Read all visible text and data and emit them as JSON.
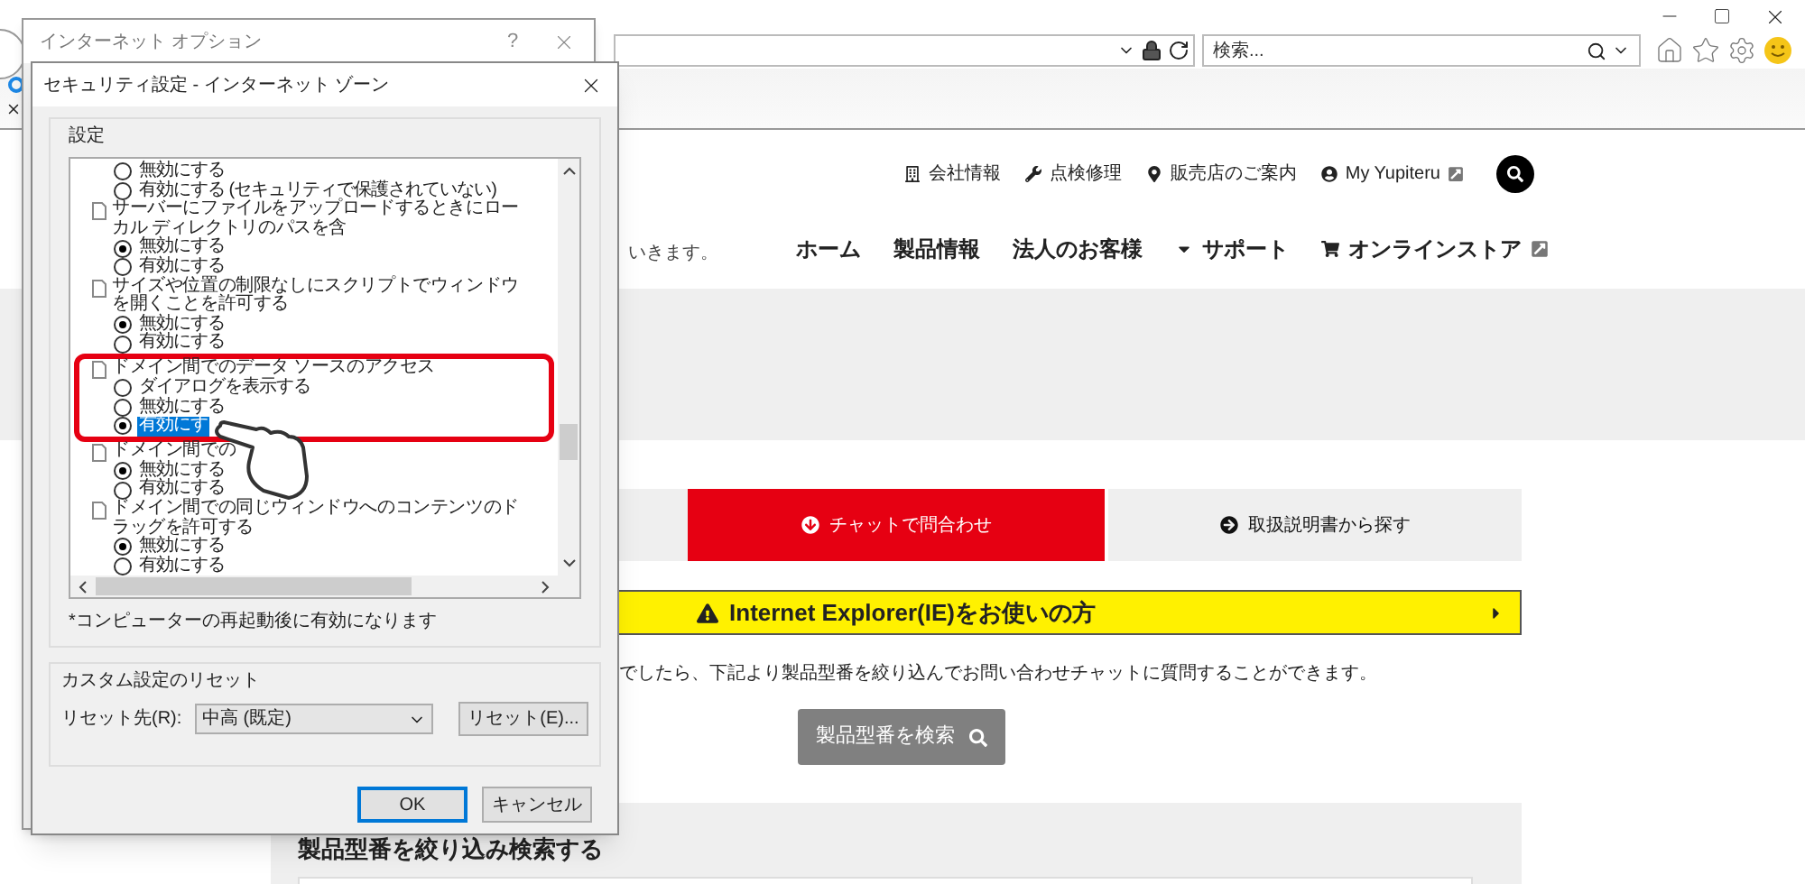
{
  "browser": {
    "search_placeholder": "検索..."
  },
  "site": {
    "utility_links": [
      {
        "label": "会社情報",
        "external": false
      },
      {
        "label": "点検修理",
        "external": false
      },
      {
        "label": "販売店のご案内",
        "external": false
      },
      {
        "label": "My Yupiteru",
        "external": true
      }
    ],
    "main_nav": [
      {
        "label": "ホーム",
        "has_menu": false,
        "external": false
      },
      {
        "label": "製品情報",
        "has_menu": false,
        "external": false
      },
      {
        "label": "法人のお客様",
        "has_menu": false,
        "external": false
      },
      {
        "label": "サポート",
        "has_menu": true,
        "external": false
      },
      {
        "label": "オンラインストア",
        "has_menu": false,
        "external": true
      }
    ],
    "tagline": "いきます。",
    "contact_tabs": [
      {
        "label": "チャットで問合わせ",
        "selected": true
      },
      {
        "label": "取扱説明書から探す",
        "selected": false
      }
    ],
    "ie_banner": "Internet Explorer(IE)をお使いの方",
    "description": "でしたら、下記より製品型番を絞り込んでお問い合わせチャットに質問することができます。",
    "search_button": "製品型番を検索",
    "section_heading": "製品型番を絞り込み検索する"
  },
  "options_dialog": {
    "title": "インターネット オプション",
    "help": "?"
  },
  "security_dialog": {
    "title": "セキュリティ設定 - インターネット ゾーン",
    "settings_label": "設定",
    "items": [
      {
        "kind": "option",
        "label": "無効にする",
        "selected": false,
        "callout": false
      },
      {
        "kind": "option",
        "label": "有効にする (セキュリティで保護されていない)",
        "selected": false,
        "callout": false
      },
      {
        "kind": "group",
        "label": "サーバーにファイルをアップロードするときにローカル ディレクトリのパスを含",
        "callout": false
      },
      {
        "kind": "option",
        "label": "無効にする",
        "selected": true,
        "callout": false
      },
      {
        "kind": "option",
        "label": "有効にする",
        "selected": false,
        "callout": false
      },
      {
        "kind": "group",
        "label": "サイズや位置の制限なしにスクリプトでウィンドウを開くことを許可する",
        "callout": false
      },
      {
        "kind": "option",
        "label": "無効にする",
        "selected": true,
        "callout": false
      },
      {
        "kind": "option",
        "label": "有効にする",
        "selected": false,
        "callout": false
      },
      {
        "kind": "group",
        "label": "ドメイン間でのデータ ソースのアクセス",
        "callout": true
      },
      {
        "kind": "option",
        "label": "ダイアログを表示する",
        "selected": false,
        "callout": true
      },
      {
        "kind": "option",
        "label": "無効にする",
        "selected": false,
        "callout": true
      },
      {
        "kind": "option",
        "label": "有効にす",
        "selected": true,
        "focused": true,
        "callout": true
      },
      {
        "kind": "group",
        "label": "ドメイン間での",
        "callout": false
      },
      {
        "kind": "option",
        "label": "無効にする",
        "selected": true,
        "callout": false
      },
      {
        "kind": "option",
        "label": "有効にする",
        "selected": false,
        "callout": false
      },
      {
        "kind": "group",
        "label": "ドメイン間での同じウィンドウへのコンテンツのドラッグを許可する",
        "callout": false
      },
      {
        "kind": "option",
        "label": "無効にする",
        "selected": true,
        "callout": false
      },
      {
        "kind": "option",
        "label": "有効にする",
        "selected": false,
        "callout": false
      }
    ],
    "note": "*コンピューターの再起動後に有効になります",
    "reset_group": "カスタム設定のリセット",
    "reset_label": "リセット先(R):",
    "reset_value": "中高 (既定)",
    "reset_button": "リセット(E)...",
    "buttons": [
      {
        "label": "OK",
        "default": true
      },
      {
        "label": "キャンセル",
        "default": false
      }
    ]
  }
}
